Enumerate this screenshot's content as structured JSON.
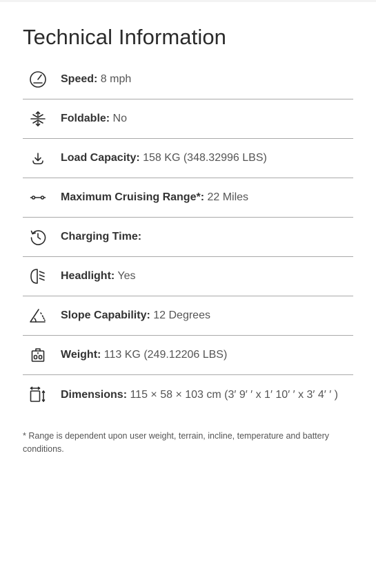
{
  "page": {
    "title": "Technical Information"
  },
  "specs": [
    {
      "icon": "speedometer-icon",
      "label": "Speed:",
      "value": " 8 mph"
    },
    {
      "icon": "foldable-arrows-icon",
      "label": "Foldable:",
      "value": " No"
    },
    {
      "icon": "download-load-icon",
      "label": "Load Capacity:",
      "value": " 158 KG (348.32996 LBS)"
    },
    {
      "icon": "range-dots-icon",
      "label": "Maximum Cruising Range*:",
      "value": " 22 Miles"
    },
    {
      "icon": "clock-history-icon",
      "label": "Charging Time:",
      "value": ""
    },
    {
      "icon": "headlight-icon",
      "label": "Headlight:",
      "value": " Yes"
    },
    {
      "icon": "slope-triangle-icon",
      "label": "Slope Capability:",
      "value": " 12 Degrees"
    },
    {
      "icon": "weight-scale-icon",
      "label": "Weight:",
      "value": " 113 KG (249.12206 LBS)"
    },
    {
      "icon": "dimensions-icon",
      "label": "Dimensions:",
      "value": " 115 × 58 × 103 cm (3′ 9′ ′ x 1′ 10′ ′ x 3′ 4′ ′ )"
    }
  ],
  "footnote": "* Range is dependent upon user weight, terrain, incline, temperature and battery conditions."
}
